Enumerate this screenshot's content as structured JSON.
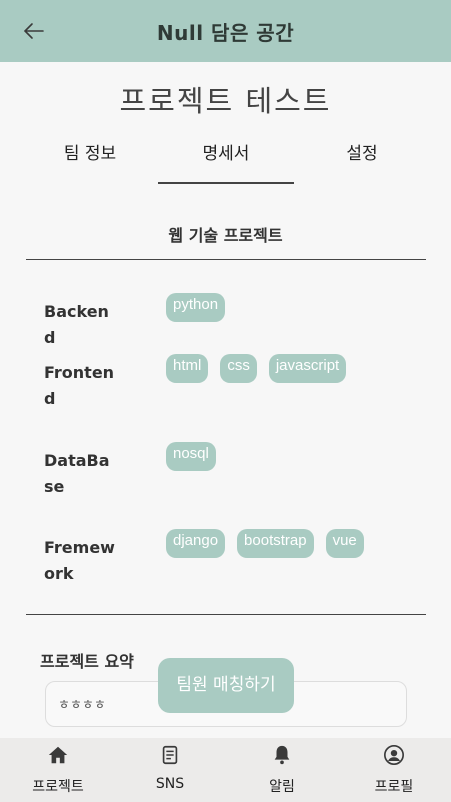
{
  "appbar": {
    "title": "Null 담은 공간",
    "back_icon": "arrow-left-icon"
  },
  "project": {
    "title": "프로젝트 테스트"
  },
  "tabs": [
    {
      "label": "팀 정보"
    },
    {
      "label": "명세서",
      "active": true
    },
    {
      "label": "설정"
    }
  ],
  "spec": {
    "heading": "웹 기술 프로젝트",
    "rows": [
      {
        "label": "Backend",
        "chips": [
          "python"
        ]
      },
      {
        "label": "Frontend",
        "chips": [
          "html",
          "css",
          "javascript"
        ]
      },
      {
        "label": "DataBase",
        "chips": [
          "nosql"
        ]
      },
      {
        "label": "Framework",
        "label_display": "Fremework",
        "chips": [
          "django",
          "bootstrap",
          "vue"
        ]
      }
    ]
  },
  "summary": {
    "label": "프로젝트 요약",
    "value": "ㅎㅎㅎㅎ"
  },
  "match_button": {
    "label": "팀원 매칭하기"
  },
  "bottom_nav": [
    {
      "label": "프로젝트",
      "icon": "home-icon"
    },
    {
      "label": "SNS",
      "icon": "document-icon"
    },
    {
      "label": "알림",
      "icon": "bell-icon"
    },
    {
      "label": "프로필",
      "icon": "profile-icon"
    }
  ],
  "colors": {
    "accent": "#a9cbc2",
    "background": "#f7f7f7",
    "nav_background": "#ecebea"
  }
}
